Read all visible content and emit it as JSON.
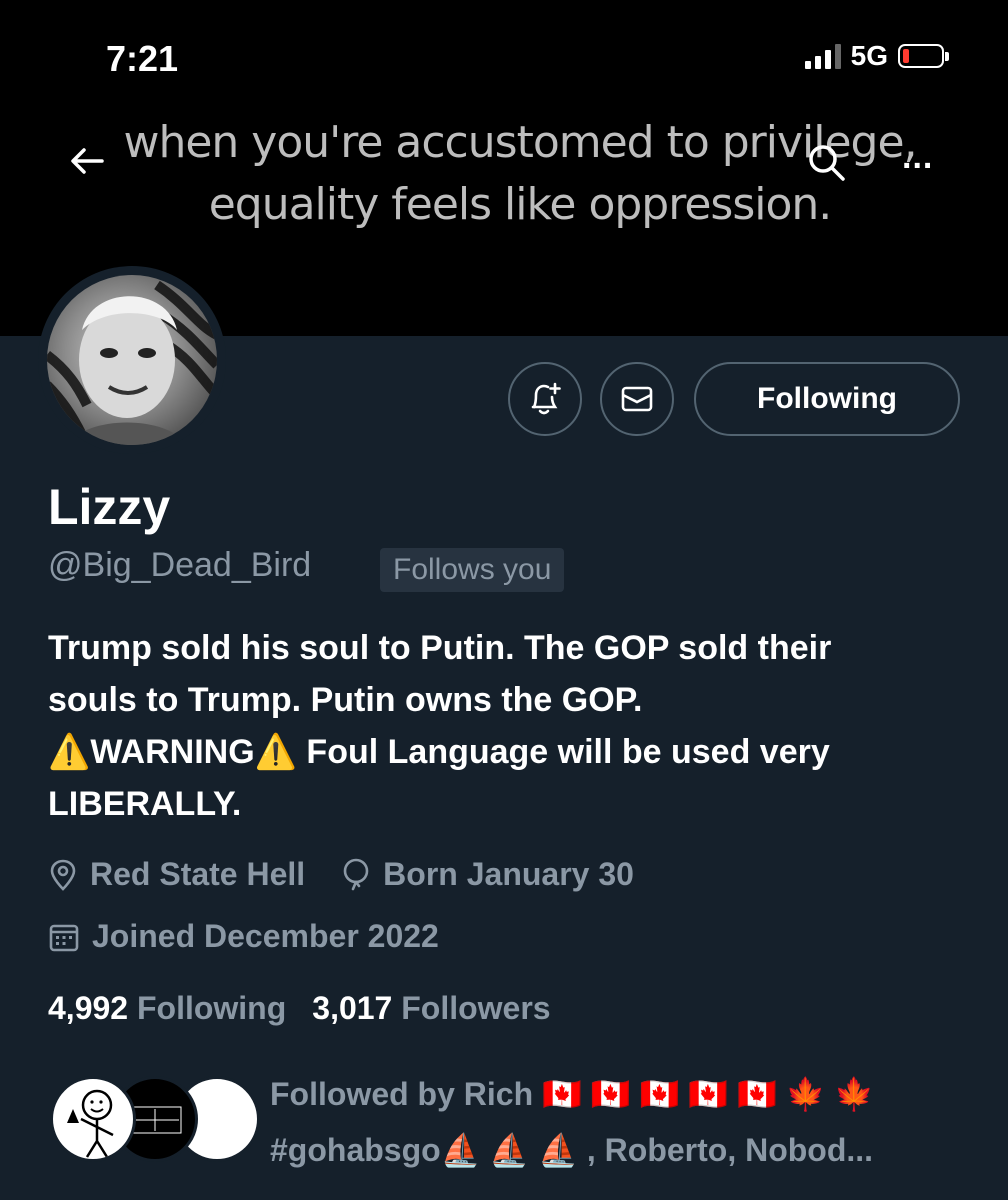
{
  "status_bar": {
    "time": "7:21",
    "network": "5G"
  },
  "banner": {
    "quote_line1": "when you're accustomed to privilege,",
    "quote_line2": "equality feels like oppression."
  },
  "nav": {
    "back_icon": "back-arrow-icon",
    "search_icon": "search-icon",
    "more_label": "..."
  },
  "actions": {
    "notify_icon": "bell-plus-icon",
    "message_icon": "envelope-icon",
    "follow_label": "Following"
  },
  "profile": {
    "name": "Lizzy",
    "handle": "@Big_Dead_Bird",
    "follows_you": "Follows you",
    "bio_line1": "Trump sold his soul to Putin. The GOP sold their",
    "bio_line2": "souls to Trump. Putin owns the GOP.",
    "bio_line3": "⚠️WARNING⚠️ Foul Language will be used very",
    "bio_line4": "LIBERALLY.",
    "location": "Red State Hell",
    "birthday": "Born January 30",
    "joined": "Joined December 2022"
  },
  "stats": {
    "following_count": "4,992",
    "following_label": "Following",
    "followers_count": "3,017",
    "followers_label": "Followers"
  },
  "followed_by": {
    "line1": "Followed by Rich 🇨🇦 🇨🇦 🇨🇦 🇨🇦 🇨🇦 🍁 🍁",
    "line2": "#gohabsgo⛵ ⛵ ⛵ , Roberto, Nobod..."
  },
  "colors": {
    "background": "#15202b",
    "secondary_text": "#8b98a5",
    "border": "#536471"
  }
}
